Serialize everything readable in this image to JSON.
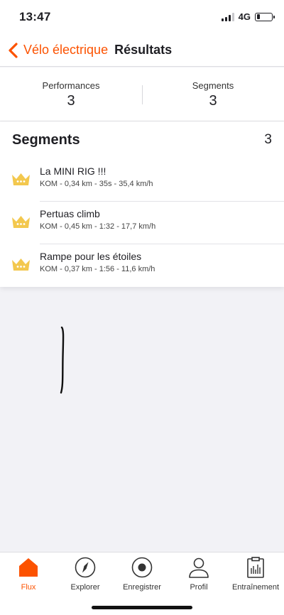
{
  "status": {
    "time": "13:47",
    "network": "4G"
  },
  "nav": {
    "back_label": "Vélo électrique",
    "title": "Résultats"
  },
  "summary": [
    {
      "label": "Performances",
      "value": "3"
    },
    {
      "label": "Segments",
      "value": "3"
    }
  ],
  "segments": {
    "title": "Segments",
    "count": "3",
    "items": [
      {
        "name": "La MINI RIG !!!",
        "meta": "KOM - 0,34 km - 35s - 35,4 km/h",
        "icon": "crown-icon"
      },
      {
        "name": "Pertuas climb",
        "meta": "KOM - 0,45 km - 1:32 - 17,7 km/h",
        "icon": "crown-icon"
      },
      {
        "name": "Rampe pour les étoiles",
        "meta": "KOM - 0,37 km - 1:56 - 11,6 km/h",
        "icon": "crown-icon"
      }
    ]
  },
  "tabbar": {
    "tabs": [
      {
        "label": "Flux",
        "icon": "home-icon",
        "active": true
      },
      {
        "label": "Explorer",
        "icon": "compass-icon"
      },
      {
        "label": "Enregistrer",
        "icon": "record-icon"
      },
      {
        "label": "Profil",
        "icon": "person-icon"
      },
      {
        "label": "Entraînement",
        "icon": "clipboard-chart-icon"
      }
    ]
  },
  "colors": {
    "accent": "#fc5200",
    "crown": "#f3c84e",
    "background": "#f2f2f6"
  }
}
